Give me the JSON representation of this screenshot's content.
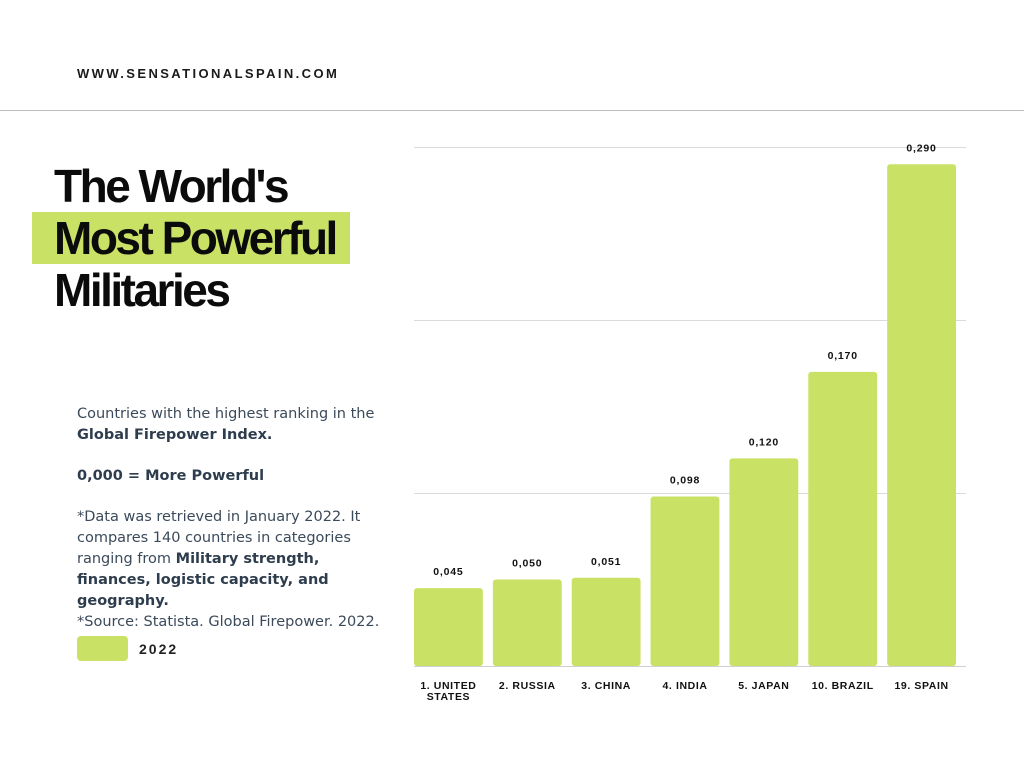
{
  "site": {
    "url": "WWW.SENSATIONALSPAIN.COM"
  },
  "title": {
    "line1": "The World's",
    "line2": "Most Powerful",
    "line3": "Militaries"
  },
  "description": {
    "p1_text": "Countries with the highest ranking in the",
    "p1_bold": "Global Firepower Index.",
    "p2_bold": "0,000 = More Powerful",
    "p3_text1": "*Data was retrieved in January 2022. It compares 140 countries in categories ranging from",
    "p3_bold": "Military strength, finances, logistic capacity, and geography.",
    "p3_source": "*Source: Statista. Global Firepower. 2022."
  },
  "legend": {
    "label": "2022",
    "color": "#c9e265"
  },
  "chart_data": {
    "type": "bar",
    "categories": [
      "1. UNITED STATES",
      "2. RUSSIA",
      "3. CHINA",
      "4. INDIA",
      "5. JAPAN",
      "10. BRAZIL",
      "19. SPAIN"
    ],
    "series": [
      {
        "name": "2022",
        "values": [
          0.045,
          0.05,
          0.051,
          0.098,
          0.12,
          0.17,
          0.29
        ],
        "color": "#c9e265"
      }
    ],
    "value_labels": [
      "0,045",
      "0,050",
      "0,051",
      "0,098",
      "0,120",
      "0,170",
      "0,290"
    ],
    "ylim": [
      0,
      0.3
    ],
    "yticks": [
      0,
      0.1,
      0.2,
      0.3
    ],
    "grid": true,
    "legend_position": "left"
  }
}
